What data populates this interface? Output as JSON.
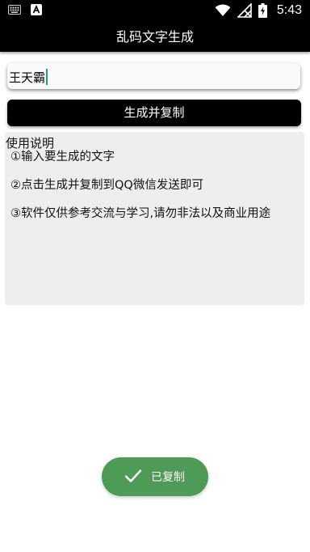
{
  "status_bar": {
    "time": "5:43",
    "left_icons": [
      "keyboard-icon",
      "font-a-icon"
    ],
    "right_icons": [
      "wifi-icon",
      "signal-off-icon",
      "battery-charging-icon"
    ]
  },
  "app_bar": {
    "title": "乱码文字生成"
  },
  "input": {
    "value": "王天霸"
  },
  "button": {
    "label": "生成并复制"
  },
  "instructions": {
    "title": "使用说明",
    "lines": [
      "①输入要生成的文字",
      "②点击生成并复制到QQ微信发送即可",
      "③软件仅供参考交流与学习,请勿非法以及商业用途"
    ]
  },
  "toast": {
    "icon": "check-icon",
    "text": "已复制",
    "color": "#4e9a57"
  },
  "colors": {
    "bar_background": "#000000",
    "instructions_background": "#eeeeee",
    "caret": "#1a9e8f"
  }
}
